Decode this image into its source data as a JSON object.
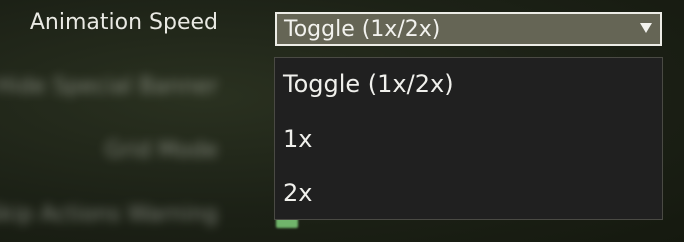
{
  "setting": {
    "label": "Animation Speed",
    "selected_value": "Toggle (1x/2x)",
    "arrow_icon": "triangle-down-icon"
  },
  "dropdown": {
    "options": [
      {
        "label": "Toggle (1x/2x)"
      },
      {
        "label": "1x"
      },
      {
        "label": "2x"
      }
    ]
  },
  "background_settings": {
    "rows": [
      {
        "label": "Hide Special Banner"
      },
      {
        "label": "Grid Mode"
      },
      {
        "label": "Skip Actions Warning"
      }
    ]
  },
  "colors": {
    "select_fill": "#656555",
    "dropdown_fill": "#202020",
    "checkbox_green": "#7fd07a"
  }
}
